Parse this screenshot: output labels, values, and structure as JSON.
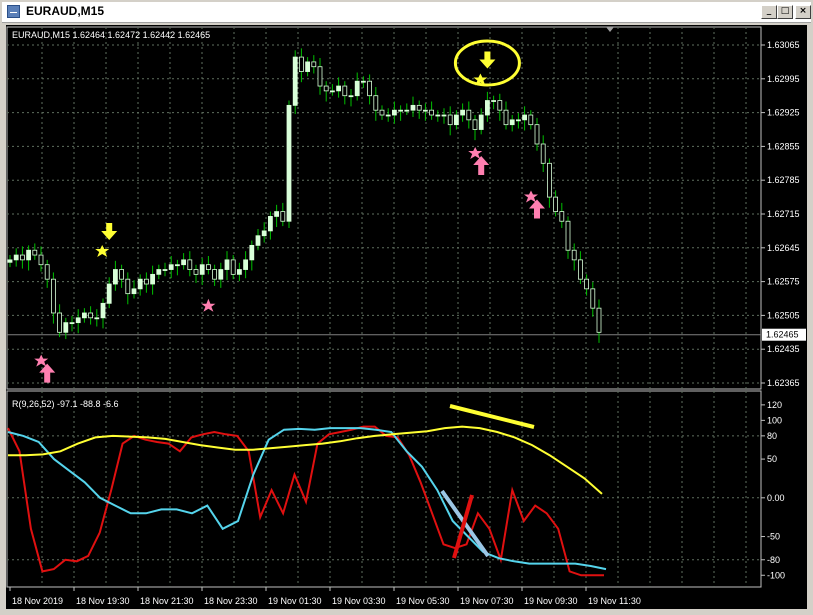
{
  "window": {
    "title": "EURAUD,M15",
    "buttons": [
      "minimize-icon",
      "maximize-icon",
      "close-icon"
    ]
  },
  "chart_header": {
    "symbol_line": "EURAUD,M15  1.62464 1.62472 1.62442 1.62465"
  },
  "indicator_header": "R(9,26,52) -97.1 -88.8 -6.6",
  "colors": {
    "background": "#000000",
    "grid": "#5f6f5f",
    "candle": "#d9ffd9",
    "bear_candle": "#000000",
    "wick": "#00c000",
    "yellow": "#ffff33",
    "pink": "#ff7fb0",
    "red": "#e01010",
    "cyan": "#55d4ec",
    "price_line": "#808080"
  },
  "chart_data": [
    {
      "type": "candlestick",
      "title": "EURAUD,M15",
      "price_axis_ticks": [
        "1.63065",
        "1.62995",
        "1.62925",
        "1.62855",
        "1.62785",
        "1.62715",
        "1.62645",
        "1.62575",
        "1.62505",
        "1.62435",
        "1.62365"
      ],
      "ylim": [
        1.62365,
        1.63065
      ],
      "current_price_label": "1.62465",
      "current_price": 1.62465,
      "time_labels": [
        "18 Nov 2019",
        "18 Nov 19:30",
        "18 Nov 21:30",
        "18 Nov 23:30",
        "19 Nov 01:30",
        "19 Nov 03:30",
        "19 Nov 05:30",
        "19 Nov 07:30",
        "19 Nov 09:30",
        "19 Nov 11:30"
      ],
      "close": [
        1.6262,
        1.6263,
        1.6262,
        1.6264,
        1.6263,
        1.6261,
        1.6258,
        1.6251,
        1.6247,
        1.6249,
        1.6249,
        1.625,
        1.6251,
        1.625,
        1.625,
        1.6253,
        1.6257,
        1.626,
        1.6258,
        1.6255,
        1.6256,
        1.6258,
        1.6257,
        1.6259,
        1.626,
        1.626,
        1.6261,
        1.6261,
        1.6262,
        1.626,
        1.6259,
        1.6261,
        1.626,
        1.6258,
        1.626,
        1.6262,
        1.6259,
        1.626,
        1.6262,
        1.6265,
        1.6267,
        1.6268,
        1.6271,
        1.6272,
        1.627,
        1.6294,
        1.6304,
        1.6301,
        1.6303,
        1.6302,
        1.6298,
        1.6297,
        1.6297,
        1.6298,
        1.6296,
        1.6296,
        1.6299,
        1.6299,
        1.6296,
        1.6293,
        1.6292,
        1.6292,
        1.6293,
        1.6293,
        1.6293,
        1.6294,
        1.6293,
        1.6293,
        1.6292,
        1.6292,
        1.6292,
        1.629,
        1.6292,
        1.6293,
        1.6291,
        1.6289,
        1.6292,
        1.6295,
        1.6295,
        1.6293,
        1.629,
        1.6291,
        1.6291,
        1.6292,
        1.629,
        1.6286,
        1.6282,
        1.6275,
        1.6272,
        1.627,
        1.6264,
        1.6262,
        1.6258,
        1.6256,
        1.6252,
        1.6247
      ],
      "arrows": [
        {
          "type": "sell",
          "color": "yellow",
          "price": 1.62655
        },
        {
          "type": "buy",
          "color": "pink",
          "price": 1.62405
        },
        {
          "type": "buy",
          "color": "pink",
          "price": 1.62835
        },
        {
          "type": "buy",
          "color": "pink",
          "price": 1.62745
        },
        {
          "type": "sell",
          "color": "yellow",
          "price": 1.6301
        }
      ]
    },
    {
      "type": "line",
      "title": "R(9,26,52) -97.1 -88.8 -6.6",
      "y_ticks": [
        "120",
        "100",
        "80",
        "50",
        "0.00",
        "-50",
        "-80",
        "-100"
      ],
      "ylim": [
        -110,
        125
      ],
      "series": [
        {
          "name": "R(9)",
          "color": "red",
          "values": [
            90,
            60,
            -40,
            -95,
            -92,
            -80,
            -82,
            -75,
            -45,
            10,
            70,
            80,
            75,
            72,
            70,
            60,
            78,
            82,
            85,
            82,
            80,
            60,
            -25,
            10,
            -20,
            30,
            -5,
            70,
            82,
            85,
            88,
            92,
            92,
            80,
            78,
            55,
            20,
            -20,
            -60,
            -65,
            -60,
            -20,
            -40,
            -80,
            10,
            -30,
            -10,
            -20,
            -40,
            -95,
            -100,
            -100,
            -100
          ]
        },
        {
          "name": "R(26)",
          "color": "cyan",
          "values": [
            85,
            80,
            72,
            50,
            35,
            20,
            0,
            -10,
            -20,
            -20,
            -15,
            -15,
            -20,
            -10,
            -40,
            -30,
            30,
            75,
            88,
            89,
            88,
            90,
            90,
            90,
            88,
            85,
            60,
            40,
            10,
            -30,
            -50,
            -70,
            -78,
            -82,
            -85,
            -85,
            -85,
            -85,
            -88,
            -92
          ]
        },
        {
          "name": "R(52)",
          "color": "yellow",
          "values": [
            55,
            55,
            56,
            60,
            70,
            78,
            80,
            79,
            78,
            76,
            72,
            68,
            65,
            62,
            62,
            64,
            66,
            68,
            70,
            73,
            77,
            80,
            82,
            84,
            86,
            90,
            92,
            90,
            85,
            78,
            68,
            55,
            40,
            25,
            5
          ]
        }
      ]
    }
  ]
}
